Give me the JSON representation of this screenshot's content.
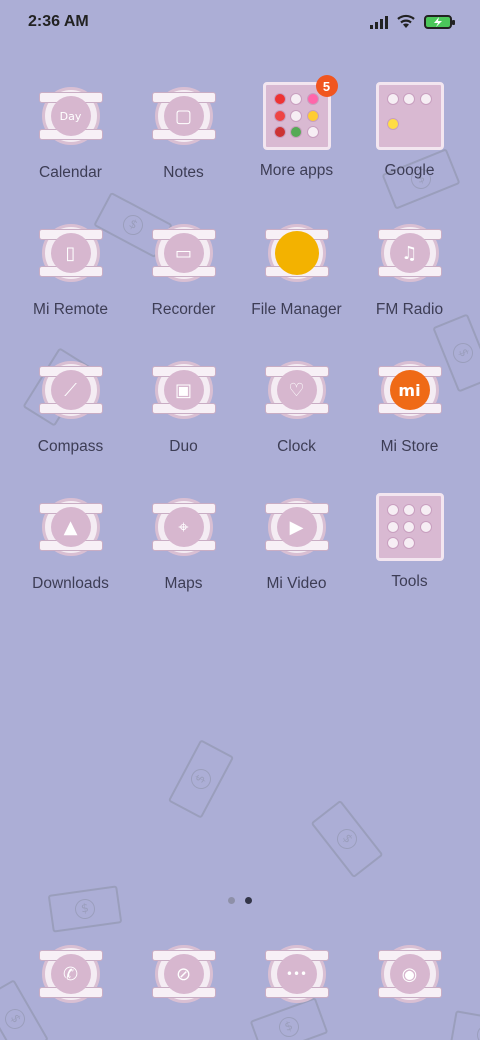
{
  "status_bar": {
    "time": "2:36 AM",
    "icons": [
      "signal-icon",
      "wifi-icon",
      "battery-charging-icon"
    ]
  },
  "apps": [
    {
      "label": "Calendar",
      "icon": "calendar-icon",
      "glyph": "Day"
    },
    {
      "label": "Notes",
      "icon": "notes-icon",
      "glyph": "▢"
    },
    {
      "label": "More apps",
      "icon": "folder-icon",
      "badge": "5"
    },
    {
      "label": "Google",
      "icon": "folder-icon"
    },
    {
      "label": "Mi Remote",
      "icon": "remote-icon",
      "glyph": "▯"
    },
    {
      "label": "Recorder",
      "icon": "recorder-icon",
      "glyph": "▭"
    },
    {
      "label": "File Manager",
      "icon": "file-manager-icon"
    },
    {
      "label": "FM Radio",
      "icon": "radio-icon",
      "glyph": "♫"
    },
    {
      "label": "Compass",
      "icon": "compass-icon",
      "glyph": "⟋"
    },
    {
      "label": "Duo",
      "icon": "duo-icon",
      "glyph": "▣"
    },
    {
      "label": "Clock",
      "icon": "clock-icon",
      "glyph": "♡"
    },
    {
      "label": "Mi Store",
      "icon": "mi-store-icon",
      "glyph": "mi"
    },
    {
      "label": "Downloads",
      "icon": "downloads-icon",
      "glyph": "▲"
    },
    {
      "label": "Maps",
      "icon": "maps-icon",
      "glyph": "⌖"
    },
    {
      "label": "Mi Video",
      "icon": "video-icon",
      "glyph": "▶"
    },
    {
      "label": "Tools",
      "icon": "folder-icon"
    }
  ],
  "dock": [
    {
      "icon": "phone-icon",
      "glyph": "✆"
    },
    {
      "icon": "browser-icon",
      "glyph": "⊘"
    },
    {
      "icon": "messaging-icon",
      "glyph": "•••"
    },
    {
      "icon": "camera-icon",
      "glyph": "◉"
    }
  ],
  "page_indicator": {
    "pages": 2,
    "current": 2
  },
  "colors": {
    "wallpaper": "#acaed6",
    "badge": "#f1551f",
    "icon_pink": "#d7b7cf"
  }
}
